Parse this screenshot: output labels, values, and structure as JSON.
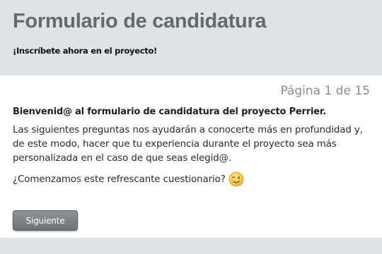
{
  "header": {
    "title": "Formulario de candidatura",
    "subtitle": "¡Inscríbete ahora en el proyecto!"
  },
  "panel": {
    "page_indicator": "Página 1 de 15",
    "welcome": "Bienvenid@ al formulario de candidatura del proyecto Perrier.",
    "intro": "Las siguientes preguntas nos ayudarán a conocerte más en profundidad y, de este modo, hacer que tu experiencia durante el proyecto sea más personalizada en el caso de que seas elegid@.",
    "question": "¿Comenzamos este refrescante cuestionario?",
    "emoji_icon": "winking-face-icon",
    "next_label": "Siguiente"
  },
  "colors": {
    "header_bg": "#dde3e6",
    "title_text": "#636a6e",
    "panel_bg": "#ffffff",
    "button_bg": "#7a8084"
  }
}
